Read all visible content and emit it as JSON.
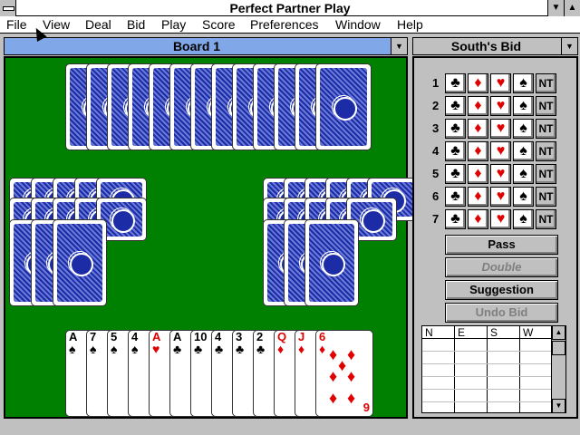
{
  "window": {
    "title": "Perfect Partner Play"
  },
  "menu": [
    "File",
    "View",
    "Deal",
    "Bid",
    "Play",
    "Score",
    "Preferences",
    "Window",
    "Help"
  ],
  "board_header": {
    "label": "Board 1"
  },
  "bid_header": {
    "label": "South's Bid"
  },
  "bid_grid": {
    "levels": [
      "1",
      "2",
      "3",
      "4",
      "5",
      "6",
      "7"
    ],
    "suits": [
      {
        "symbol": "♣",
        "color": "#000000",
        "name": "clubs"
      },
      {
        "symbol": "♦",
        "color": "#e00000",
        "name": "diamonds"
      },
      {
        "symbol": "♥",
        "color": "#e00000",
        "name": "hearts"
      },
      {
        "symbol": "♠",
        "color": "#000000",
        "name": "spades"
      },
      {
        "symbol": "NT",
        "color": "#000000",
        "name": "notrump"
      }
    ]
  },
  "actions": {
    "pass": "Pass",
    "double": "Double",
    "suggestion": "Suggestion",
    "undo": "Undo Bid"
  },
  "history": {
    "columns": [
      "N",
      "E",
      "S",
      "W"
    ]
  },
  "south_hand": [
    {
      "rank": "A",
      "suit": "♠",
      "color": "#000000"
    },
    {
      "rank": "7",
      "suit": "♠",
      "color": "#000000"
    },
    {
      "rank": "5",
      "suit": "♠",
      "color": "#000000"
    },
    {
      "rank": "4",
      "suit": "♠",
      "color": "#000000"
    },
    {
      "rank": "A",
      "suit": "♥",
      "color": "#e00000"
    },
    {
      "rank": "A",
      "suit": "♣",
      "color": "#000000"
    },
    {
      "rank": "10",
      "suit": "♣",
      "color": "#000000"
    },
    {
      "rank": "4",
      "suit": "♣",
      "color": "#000000"
    },
    {
      "rank": "3",
      "suit": "♣",
      "color": "#000000"
    },
    {
      "rank": "2",
      "suit": "♣",
      "color": "#000000"
    },
    {
      "rank": "Q",
      "suit": "♦",
      "color": "#e00000"
    },
    {
      "rank": "J",
      "suit": "♦",
      "color": "#e00000"
    },
    {
      "rank": "6",
      "suit": "♦",
      "color": "#e00000"
    }
  ],
  "last_card_corner": "9"
}
